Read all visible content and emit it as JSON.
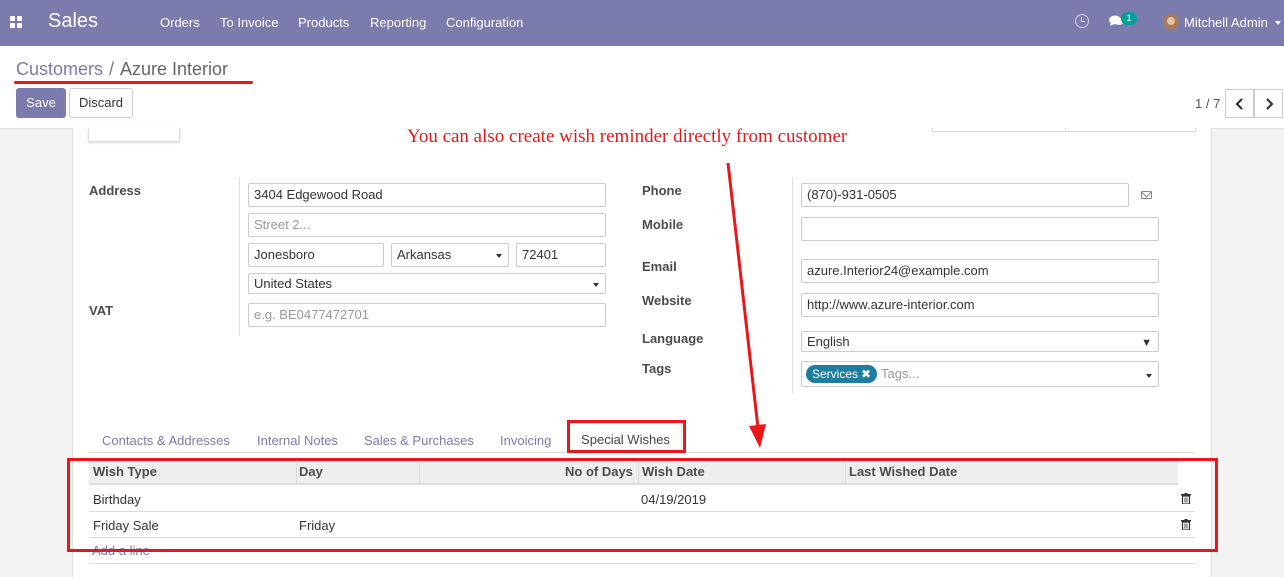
{
  "navbar": {
    "app_name": "Sales",
    "menu": [
      "Orders",
      "To Invoice",
      "Products",
      "Reporting",
      "Configuration"
    ],
    "chat_count": "1",
    "user_name": "Mitchell Admin",
    "icons": [
      "apps-grid-icon",
      "clock-icon",
      "chat-icon",
      "user-avatar",
      "caret-down-icon"
    ]
  },
  "breadcrumb": {
    "parent": "Customers",
    "separator": "/",
    "current": "Azure Interior"
  },
  "actions": {
    "save_label": "Save",
    "discard_label": "Discard"
  },
  "pager": {
    "value": "1 / 7"
  },
  "annotation": {
    "text": "You can also create wish reminder directly from customer"
  },
  "form": {
    "address_label": "Address",
    "street": "3404  Edgewood Road",
    "street2_placeholder": "Street 2...",
    "city": "Jonesboro",
    "state": "Arkansas",
    "zip": "72401",
    "country": "United States",
    "vat_label": "VAT",
    "vat_placeholder": "e.g. BE0477472701",
    "phone_label": "Phone",
    "phone": "(870)-931-0505",
    "mobile_label": "Mobile",
    "mobile": "",
    "email_label": "Email",
    "email": "azure.Interior24@example.com",
    "website_label": "Website",
    "website": "http://www.azure-interior.com",
    "language_label": "Language",
    "language": "English",
    "tags_label": "Tags",
    "tags": [
      "Services"
    ],
    "tags_placeholder": "Tags..."
  },
  "tabs": {
    "items": [
      "Contacts & Addresses",
      "Internal Notes",
      "Sales & Purchases",
      "Invoicing",
      "Special Wishes"
    ],
    "active": "Special Wishes"
  },
  "wishes_table": {
    "columns": [
      "Wish Type",
      "Day",
      "No of Days",
      "Wish Date",
      "Last Wished Date"
    ],
    "rows": [
      {
        "wish_type": "Birthday",
        "day": "",
        "no_of_days": "",
        "wish_date": "04/19/2019",
        "last_wished_date": ""
      },
      {
        "wish_type": "Friday Sale",
        "day": "Friday",
        "no_of_days": "",
        "wish_date": "",
        "last_wished_date": ""
      }
    ],
    "add_line_label": "Add a line"
  },
  "colors": {
    "brand": "#7c7bad",
    "annotation_red": "#e8171a",
    "tag": "#1e7ea1",
    "badge": "#00a09d"
  }
}
